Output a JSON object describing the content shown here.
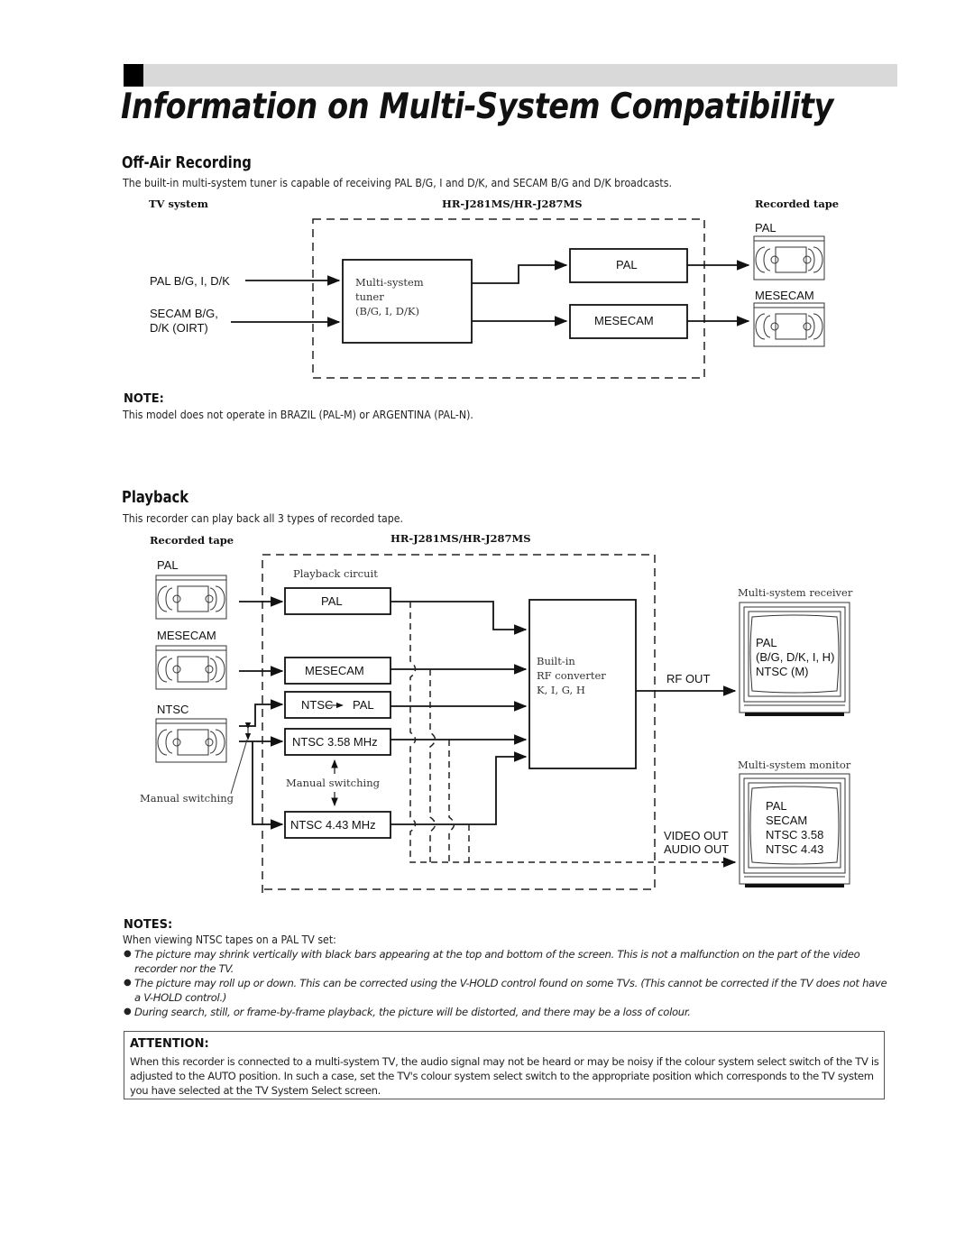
{
  "page": {
    "title": "Information on Multi-System Compatibility"
  },
  "off_air": {
    "heading": "Off-Air Recording",
    "intro": "The built-in multi-system tuner is capable of receiving PAL B/G, I and D/K, and SECAM B/G and D/K broadcasts.",
    "col_tv_system": "TV system",
    "col_model": "HR-J281MS/HR-J287MS",
    "col_recorded_tape": "Recorded tape",
    "inputs": [
      "PAL B/G, I, D/K",
      "SECAM B/G,",
      "D/K (OIRT)"
    ],
    "tuner": [
      "Multi-system",
      "tuner",
      "(B/G, I, D/K)"
    ],
    "outputs": [
      "PAL",
      "MESECAM"
    ],
    "tapes": [
      "PAL",
      "MESECAM"
    ],
    "note_heading": "NOTE:",
    "note_text": "This model does not operate in BRAZIL (PAL-M) or ARGENTINA (PAL-N)."
  },
  "playback": {
    "heading": "Playback",
    "intro": "This recorder can play back all 3 types of recorded tape.",
    "col_recorded_tape": "Recorded tape",
    "col_model": "HR-J281MS/HR-J287MS",
    "tapes": [
      "PAL",
      "MESECAM",
      "NTSC"
    ],
    "circuit_label": "Playback circuit",
    "circuits": [
      "PAL",
      "MESECAM",
      "NTSC",
      "PAL",
      "NTSC 3.58 MHz",
      "NTSC 4.43 MHz"
    ],
    "manual_switching": "Manual switching",
    "manual_switching_tape": "Manual switching",
    "rf_converter": [
      "Built-in",
      "RF converter",
      "K, I, G, H"
    ],
    "rf_out": "RF OUT",
    "video_out": "VIDEO OUT",
    "audio_out": "AUDIO OUT",
    "receiver_label": "Multi-system receiver",
    "receiver_screen": [
      "PAL",
      "(B/G, D/K, I, H)",
      "NTSC (M)"
    ],
    "monitor_label": "Multi-system monitor",
    "monitor_screen": [
      "PAL",
      "SECAM",
      "NTSC 3.58",
      "NTSC 4.43"
    ]
  },
  "notes": {
    "heading": "NOTES:",
    "lead": "When viewing NTSC tapes on a PAL TV set:",
    "items": [
      "The picture may shrink vertically with black bars appearing at the top and bottom of the screen. This is not a malfunction on the part of the video recorder nor the TV.",
      "The picture may roll up or down. This can be corrected using the V-HOLD control found on some TVs. (This cannot be corrected if the TV does not have a V-HOLD control.)",
      "During search, still, or frame-by-frame playback, the picture will be distorted, and there may be a loss of colour."
    ]
  },
  "attention": {
    "heading": "ATTENTION:",
    "text": "When this recorder is connected to a multi-system TV, the audio signal may not be heard or may be noisy if the colour system select switch of the TV is adjusted to the AUTO position. In such a case, set the TV's colour system select switch to the appropriate position which corresponds to the TV system you have selected at the TV System Select screen."
  },
  "colors": {
    "header_bar": "#d9d9d9",
    "ink": "#111111"
  }
}
